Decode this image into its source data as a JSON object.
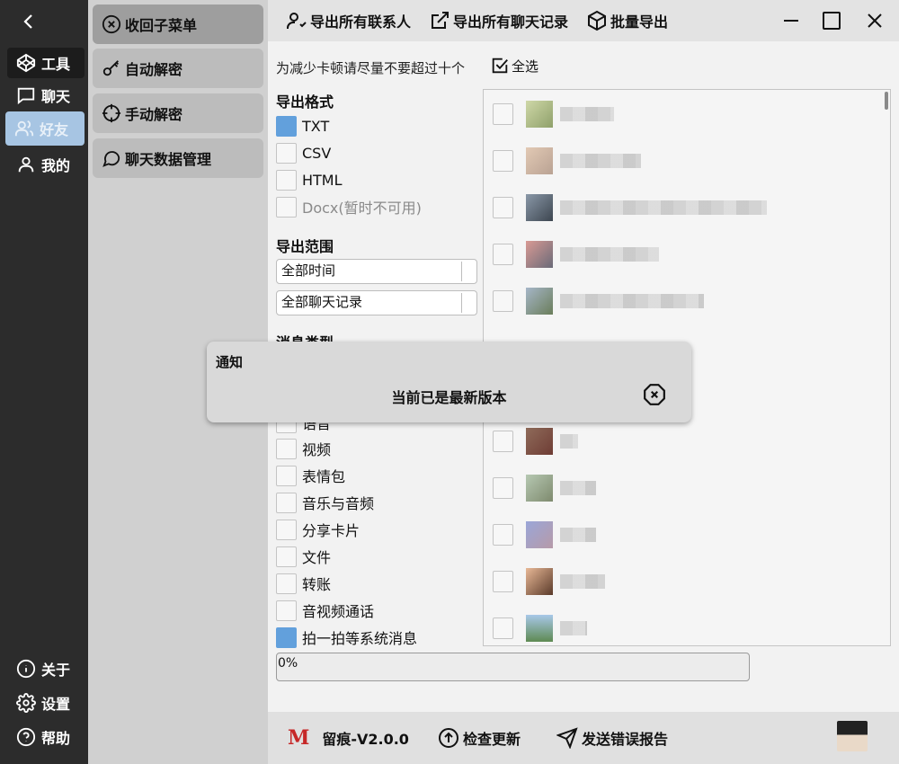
{
  "nav": {
    "items": [
      {
        "label": "工具",
        "icon": "codepen-icon"
      },
      {
        "label": "聊天",
        "icon": "chat-bubble-icon"
      },
      {
        "label": "好友",
        "icon": "users-icon"
      },
      {
        "label": "我的",
        "icon": "user-icon"
      }
    ],
    "bottom": [
      {
        "label": "关于",
        "icon": "info-icon"
      },
      {
        "label": "设置",
        "icon": "gear-icon"
      },
      {
        "label": "帮助",
        "icon": "help-icon"
      }
    ]
  },
  "submenu": {
    "items": [
      {
        "label": "收回子菜单",
        "icon": "close-circle-icon"
      },
      {
        "label": "自动解密",
        "icon": "key-icon"
      },
      {
        "label": "手动解密",
        "icon": "crosshair-icon"
      },
      {
        "label": "聊天数据管理",
        "icon": "chat-icon"
      }
    ]
  },
  "toolbar": {
    "export_contacts": "导出所有联系人",
    "export_chats": "导出所有聊天记录",
    "batch_export": "批量导出"
  },
  "main": {
    "hint": "为减少卡顿请尽量不要超过十个",
    "select_all": "全选",
    "format_title": "导出格式",
    "formats": [
      {
        "label": "TXT",
        "checked": true,
        "disabled": false
      },
      {
        "label": "CSV",
        "checked": false,
        "disabled": false
      },
      {
        "label": "HTML",
        "checked": false,
        "disabled": false
      },
      {
        "label": "Docx(暂时不可用)",
        "checked": false,
        "disabled": true
      }
    ],
    "range_title": "导出范围",
    "range_time": "全部时间",
    "range_records": "全部聊天记录",
    "msg_type_title": "消息类型",
    "msg_types": [
      {
        "label": "语音",
        "checked": false
      },
      {
        "label": "视频",
        "checked": false
      },
      {
        "label": "表情包",
        "checked": false
      },
      {
        "label": "音乐与音频",
        "checked": false
      },
      {
        "label": "分享卡片",
        "checked": false
      },
      {
        "label": "文件",
        "checked": false
      },
      {
        "label": "转账",
        "checked": false
      },
      {
        "label": "音视频通话",
        "checked": false
      },
      {
        "label": "拍一拍等系统消息",
        "checked": true
      }
    ],
    "progress": "0%"
  },
  "footer": {
    "logo_letter": "M",
    "version": "留痕-V2.0.0",
    "check_update": "检查更新",
    "report_error": "发送错误报告"
  },
  "notice": {
    "title": "通知",
    "message": "当前已是最新版本"
  },
  "colors": {
    "accent": "#62a0dc",
    "nav_bg": "#2c2c2c",
    "submenu_bg": "#d0d0d0",
    "logo": "#c62828"
  }
}
